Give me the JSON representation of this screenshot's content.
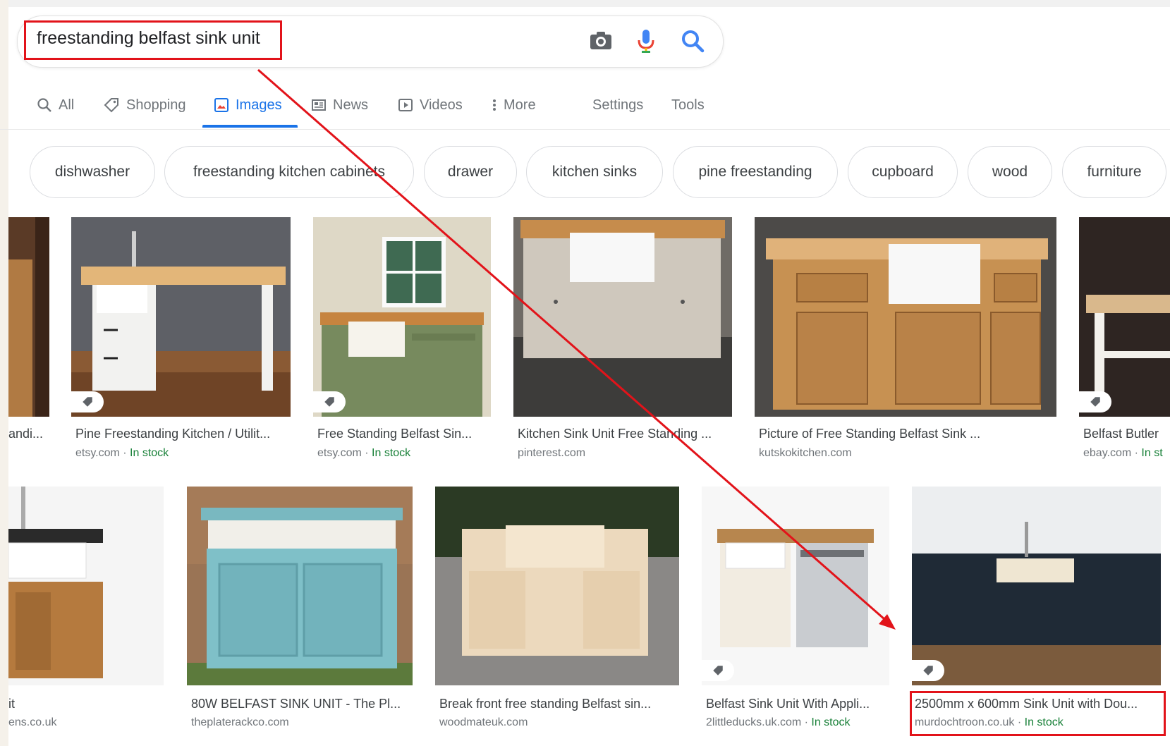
{
  "search": {
    "query": "freestanding belfast sink unit",
    "icons": [
      "camera-icon",
      "microphone-icon",
      "search-icon"
    ]
  },
  "tabs": [
    {
      "label": "All",
      "icon": "search-icon"
    },
    {
      "label": "Shopping",
      "icon": "tag-icon"
    },
    {
      "label": "Images",
      "icon": "image-icon",
      "active": true
    },
    {
      "label": "News",
      "icon": "newspaper-icon"
    },
    {
      "label": "Videos",
      "icon": "play-icon"
    },
    {
      "label": "More",
      "icon": "vertical-dots-icon"
    },
    {
      "label": "Settings"
    },
    {
      "label": "Tools"
    }
  ],
  "chips": [
    "dishwasher",
    "freestanding kitchen cabinets",
    "drawer",
    "kitchen sinks",
    "pine freestanding",
    "cupboard",
    "wood",
    "furniture"
  ],
  "results": [
    {
      "title": "andi...",
      "source": "",
      "stock": ""
    },
    {
      "title": "Pine Freestanding Kitchen / Utilit...",
      "source": "etsy.com",
      "stock": "In stock"
    },
    {
      "title": "Free Standing Belfast Sin...",
      "source": "etsy.com",
      "stock": "In stock"
    },
    {
      "title": "Kitchen Sink Unit Free Standing ...",
      "source": "pinterest.com",
      "stock": ""
    },
    {
      "title": "Picture of Free Standing Belfast Sink ...",
      "source": "kutskokitchen.com",
      "stock": ""
    },
    {
      "title": "Belfast Butler",
      "source": "ebay.com",
      "stock": "In st"
    },
    {
      "title": "it",
      "source": "ens.co.uk",
      "stock": ""
    },
    {
      "title": "80W BELFAST SINK UNIT - The Pl...",
      "source": "theplaterackco.com",
      "stock": ""
    },
    {
      "title": "Break front free standing Belfast sin...",
      "source": "woodmateuk.com",
      "stock": ""
    },
    {
      "title": "Belfast Sink Unit With Appli...",
      "source": "2littleducks.uk.com",
      "stock": "In stock"
    },
    {
      "title": "2500mm x 600mm Sink Unit with Dou...",
      "source": "murdochtroon.co.uk",
      "stock": "In stock"
    }
  ],
  "source_separator": " · ",
  "colors": {
    "accent": "#1a73e8",
    "annotation": "#e2131a",
    "in_stock": "#188038"
  }
}
